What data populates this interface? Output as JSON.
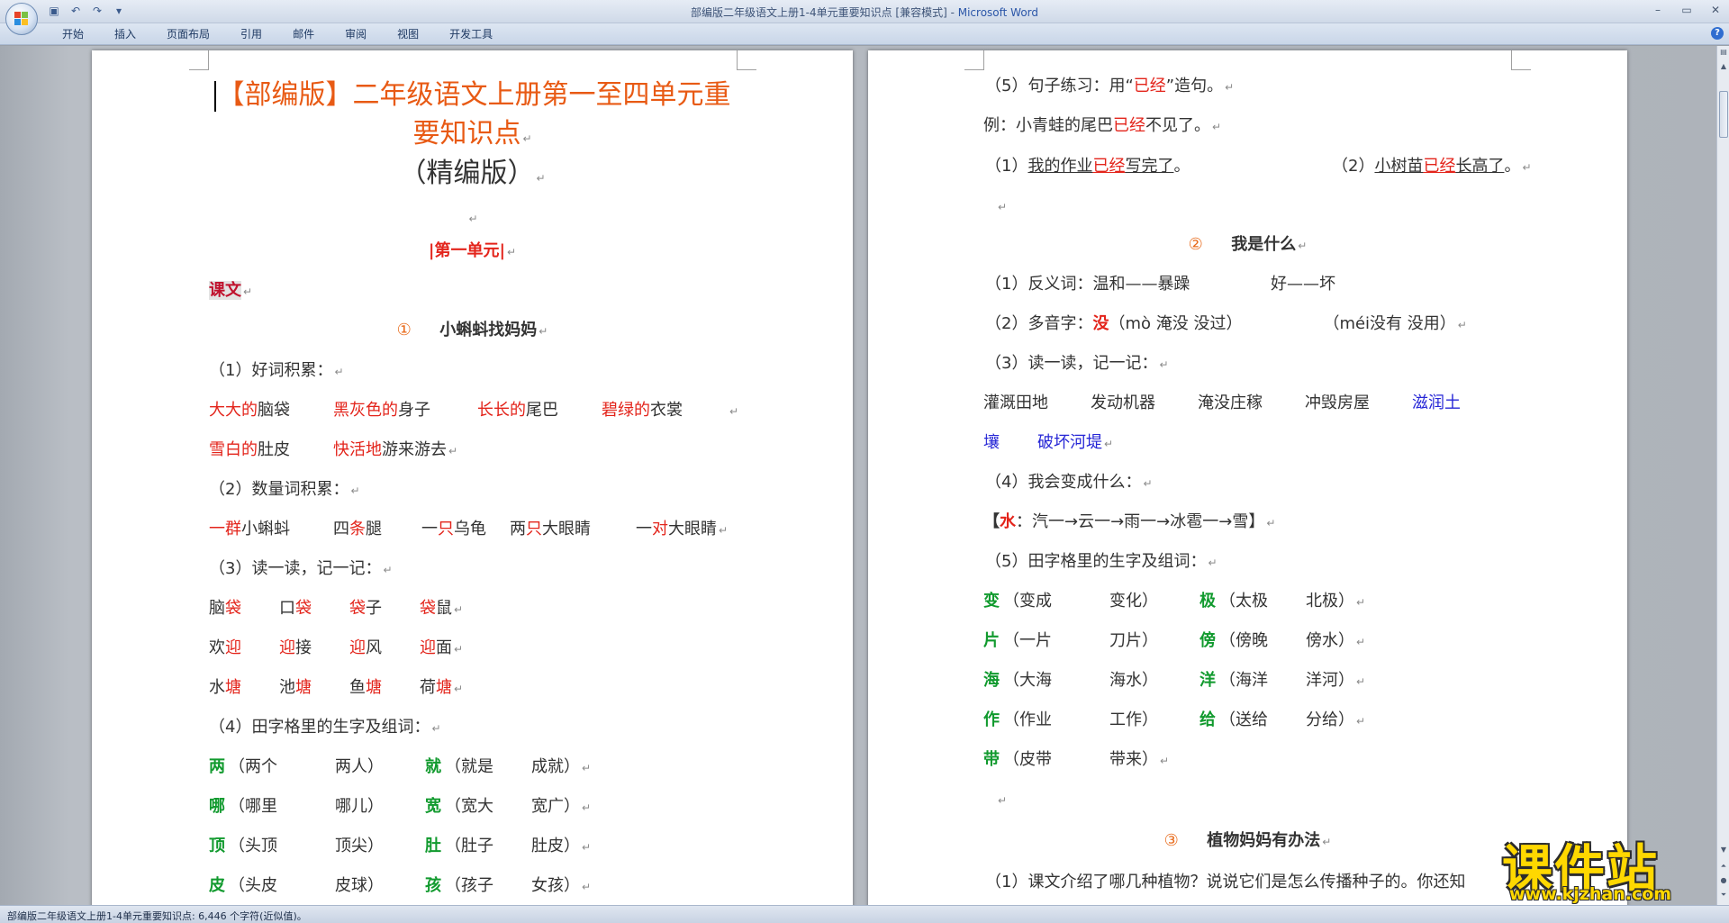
{
  "titlebar": {
    "title": "部编版二年级语文上册1-4单元重要知识点 [兼容模式] - ",
    "app_name": "Microsoft Word"
  },
  "ribbon": {
    "tabs": [
      "开始",
      "插入",
      "页面布局",
      "引用",
      "邮件",
      "审阅",
      "视图",
      "开发工具"
    ]
  },
  "page1": {
    "title_line1": "【部编版】二年级语文上册第一至四单元重",
    "title_line2": "要知识点",
    "title_line3": "（精编版）",
    "unit1": "|第一单元|",
    "kewen": "课文",
    "lesson1_num": "①",
    "lesson1_title": "小蝌蚪找妈妈",
    "s1": "（1）好词积累：",
    "w1a": "大大的",
    "w1b": "脑袋",
    "w2a": "黑灰色的",
    "w2b": "身子",
    "w3a": "长长的",
    "w3b": "尾巴",
    "w4a": "碧绿的",
    "w4b": "衣裳",
    "w5a": "雪白的",
    "w5b": "肚皮",
    "w6a": "快活地",
    "w6b": "游来游去",
    "s2": "（2）数量词积累：",
    "q1a": "一群",
    "q1b": "小蝌蚪",
    "q2a": "四",
    "q2b": "条",
    "q2c": "腿",
    "q3a": "一",
    "q3b": "只",
    "q3c": "乌龟",
    "q4a": "两",
    "q4b": "只",
    "q4c": "大眼睛",
    "q5a": "一",
    "q5b": "对",
    "q5c": "大眼睛",
    "s3": "（3）读一读，记一记：",
    "r1": [
      [
        "脑",
        "袋"
      ],
      [
        "口",
        "袋"
      ],
      [
        "袋",
        "子"
      ],
      [
        "袋",
        "鼠"
      ]
    ],
    "r2": [
      [
        "欢",
        "迎"
      ],
      [
        "迎",
        "接"
      ],
      [
        "迎",
        "风"
      ],
      [
        "迎",
        "面"
      ]
    ],
    "r3": [
      [
        "水",
        "塘"
      ],
      [
        "池",
        "塘"
      ],
      [
        "鱼",
        "塘"
      ],
      [
        "荷",
        "塘"
      ]
    ],
    "s4": "（4）田字格里的生字及组词：",
    "g1": [
      "两",
      "（两个",
      "两人）",
      "就",
      "（就是",
      "成就）"
    ],
    "g2": [
      "哪",
      "（哪里",
      "哪儿）",
      "宽",
      "（宽大",
      "宽广）"
    ],
    "g3": [
      "顶",
      "（头顶",
      "顶尖）",
      "肚",
      "（肚子",
      "肚皮）"
    ],
    "g4": [
      "皮",
      "（头皮",
      "皮球）",
      "孩",
      "（孩子",
      "女孩）"
    ]
  },
  "page2": {
    "s5a": "（5）句子练习：用“",
    "s5b": "已经",
    "s5c": "”造句。",
    "ex_a": "例：小青蛙的尾巴",
    "ex_b": "已经",
    "ex_c": "不见了。",
    "a1a": "（1）",
    "a1b": "我的作业",
    "a1c": "已经",
    "a1d": "写完了",
    "a1e": "。",
    "a2a": "（2）",
    "a2b": "小树苗",
    "a2c": "已经",
    "a2d": "长高了",
    "a2e": "。",
    "lesson2_num": "②",
    "lesson2_title": "我是什么",
    "b1": "（1）反义词：温和——暴躁",
    "b1b": "好——坏",
    "b2a": "（2）多音字：",
    "b2b": "没",
    "b2c": "（mò   淹没  没过）",
    "b2d": "（méi没有  没用）",
    "b3": "（3）读一读，记一记：",
    "c1": [
      "灌溉田地",
      "发动机器",
      "淹没庄稼",
      "冲毁房屋"
    ],
    "c1blue": "滋润土",
    "c2a": "壤",
    "c2b": "破坏河堤",
    "b4": "（4）我会变成什么：",
    "d1a": "【",
    "d1b": "水",
    "d1c": "：汽一→云一→雨一→冰雹一→雪】",
    "b5": "（5）田字格里的生字及组词：",
    "e1": [
      "变",
      "（变成",
      "变化）",
      "极",
      "（太极",
      "北极）"
    ],
    "e2": [
      "片",
      "（一片",
      "刀片）",
      "傍",
      "（傍晚",
      "傍水）"
    ],
    "e3": [
      "海",
      "（大海",
      "海水）",
      "洋",
      "（海洋",
      "洋河）"
    ],
    "e4": [
      "作",
      "（作业",
      "工作）",
      "给",
      "（送给",
      "分给）"
    ],
    "e5": [
      "带",
      "（皮带",
      "带来）"
    ],
    "lesson3_num": "③",
    "lesson3_title": "植物妈妈有办法",
    "f1": "（1）课文介绍了哪几种植物？说说它们是怎么传播种子的。你还知"
  },
  "statusbar": {
    "text": "部编版二年级语文上册1-4单元重要知识点: 6,446 个字符(近似值)。"
  },
  "watermark": {
    "main": "课件站",
    "url": "www.kjzhan.com"
  }
}
